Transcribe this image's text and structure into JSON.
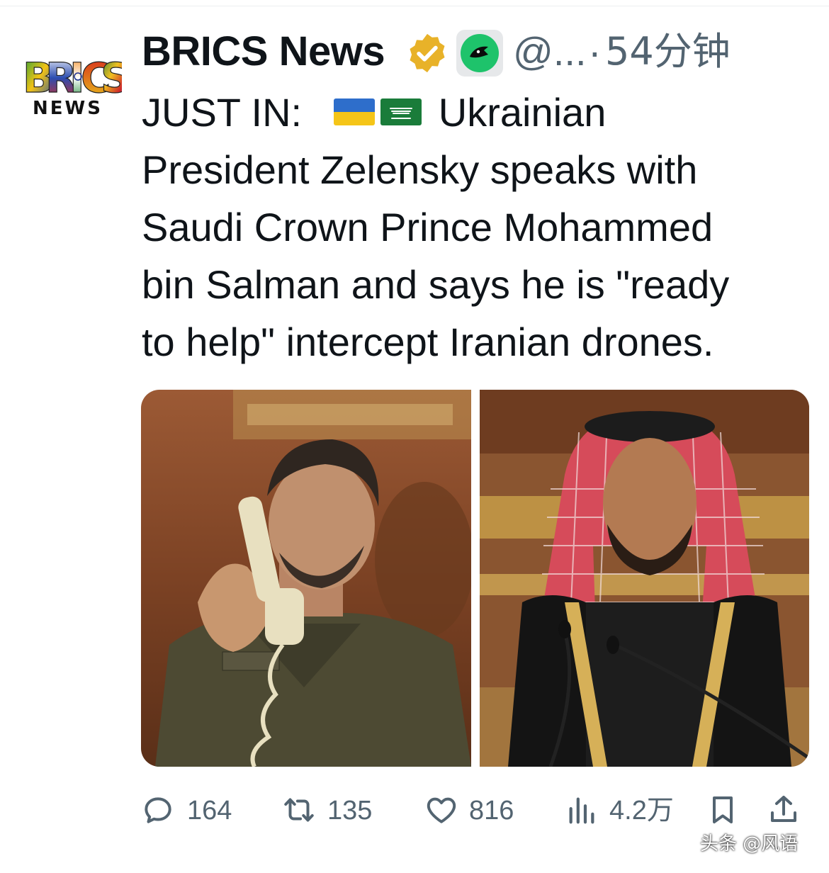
{
  "post": {
    "display_name": "BRICS News",
    "handle": "@...",
    "separator": "·",
    "timestamp": "54分钟",
    "avatar": {
      "logo_text": "BRICS",
      "logo_subtext": "NEWS"
    },
    "verified_icon": "verified-badge-icon",
    "app_icon": "media-app-icon",
    "text_lines": [
      "JUST IN:",
      "Ukrainian",
      "President Zelensky speaks with",
      "Saudi Crown Prince Mohammed",
      "bin Salman and says he is \"ready",
      "to help\" intercept Iranian drones."
    ],
    "flags": [
      "ukraine-flag-icon",
      "saudi-arabia-flag-icon"
    ]
  },
  "actions": {
    "reply": {
      "icon": "reply-icon",
      "count": "164"
    },
    "repost": {
      "icon": "repost-icon",
      "count": "135"
    },
    "like": {
      "icon": "like-icon",
      "count": "816"
    },
    "views": {
      "icon": "views-icon",
      "count": "4.2万"
    },
    "bookmark": {
      "icon": "bookmark-icon"
    },
    "share": {
      "icon": "share-icon"
    }
  },
  "watermark": "头条 @风语",
  "colors": {
    "text_primary": "#0f1419",
    "text_secondary": "#536471",
    "verified_gold": "#e8b229",
    "background": "#ffffff"
  }
}
